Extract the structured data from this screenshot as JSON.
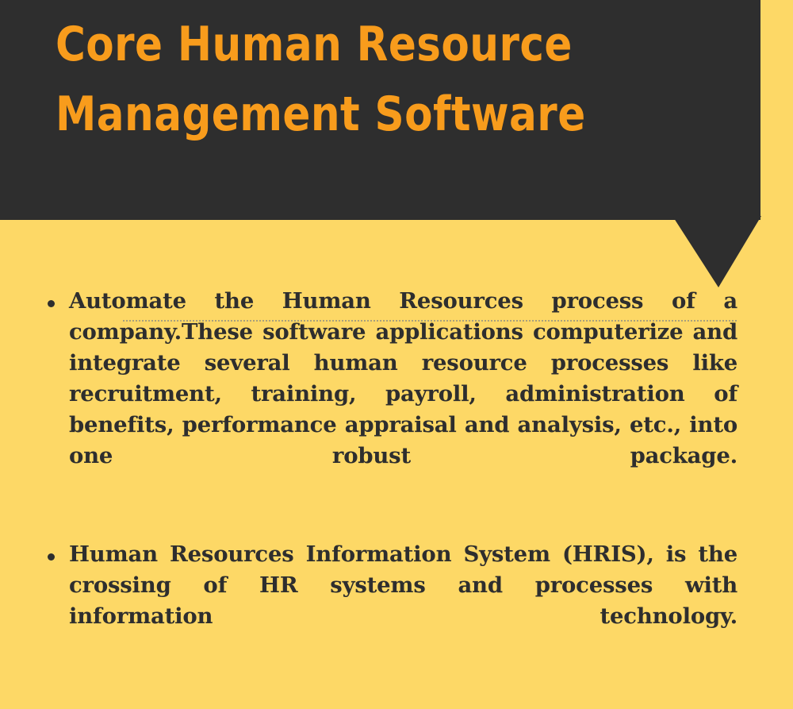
{
  "colors": {
    "background_yellow": "#FDD866",
    "header_dark": "#2E2E2E",
    "title_orange": "#F89C1C",
    "body_text": "#2E2E2E",
    "spellcheck_underline": "#8D8D84"
  },
  "header": {
    "title_line_1": "Core Human Resource",
    "title_line_2": "Management Software",
    "full_title": "Core Human Resource Management Software",
    "shape": "speech-bubble-with-tail"
  },
  "body": {
    "bullets": [
      {
        "marker": "•",
        "text": "Automate the Human Resources process of a company.These software applications computerize and integrate several human resource processes like recruitment, training, payroll, administration of benefits, performance appraisal and analysis, etc., into one robust package."
      },
      {
        "marker": "•",
        "text": "Human Resources Information System (HRIS), is the crossing of HR systems and processes with information technology.",
        "has_spellcheck_underline": true
      }
    ]
  }
}
